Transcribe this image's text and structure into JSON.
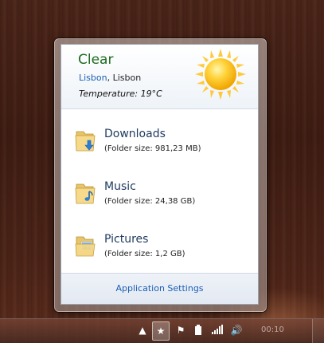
{
  "weather": {
    "condition": "Clear",
    "city": "Lisbon",
    "separator": ", ",
    "region": "Lisbon",
    "temperature": "Temperature: 19°C",
    "icon": "sun-icon"
  },
  "folders": [
    {
      "name": "Downloads",
      "size": "(Folder size: 981,23 MB)",
      "icon": "downloads-folder-icon"
    },
    {
      "name": "Music",
      "size": "(Folder size: 24,38 GB)",
      "icon": "music-folder-icon"
    },
    {
      "name": "Pictures",
      "size": "(Folder size: 1,2 GB)",
      "icon": "pictures-folder-icon"
    }
  ],
  "footer": {
    "settings_label": "Application Settings"
  },
  "taskbar": {
    "tray_icons": [
      "show-hidden-icons-arrow",
      "app-star-icon",
      "action-center-flag-icon",
      "power-icon",
      "network-signal-icon",
      "volume-icon"
    ],
    "clock": "00:10"
  },
  "colors": {
    "condition": "#1f6b1f",
    "link": "#1b5fb5",
    "folder_name": "#1e3a5f"
  }
}
